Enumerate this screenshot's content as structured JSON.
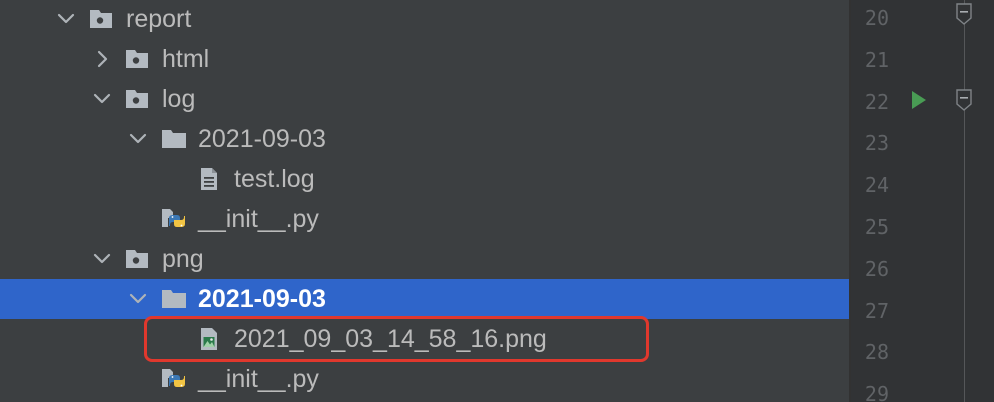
{
  "tree": {
    "rows": [
      {
        "label": "report",
        "icon": "package-folder-icon",
        "chevron": "expanded",
        "selected": false
      },
      {
        "label": "html",
        "icon": "package-folder-icon",
        "chevron": "collapsed",
        "selected": false
      },
      {
        "label": "log",
        "icon": "package-folder-icon",
        "chevron": "expanded",
        "selected": false
      },
      {
        "label": "2021-09-03",
        "icon": "folder-icon",
        "chevron": "expanded",
        "selected": false
      },
      {
        "label": "test.log",
        "icon": "text-file-icon",
        "chevron": "none",
        "selected": false
      },
      {
        "label": "__init__.py",
        "icon": "python-file-icon",
        "chevron": "none",
        "selected": false
      },
      {
        "label": "png",
        "icon": "package-folder-icon",
        "chevron": "expanded",
        "selected": false
      },
      {
        "label": "2021-09-03",
        "icon": "folder-icon",
        "chevron": "expanded",
        "selected": true
      },
      {
        "label": "2021_09_03_14_58_16.png",
        "icon": "image-file-icon",
        "chevron": "none",
        "selected": false
      },
      {
        "label": "__init__.py",
        "icon": "python-file-icon",
        "chevron": "none",
        "selected": false
      }
    ]
  },
  "gutter": {
    "line_numbers": [
      "20",
      "21",
      "22",
      "23",
      "24",
      "25",
      "26",
      "27",
      "28",
      "29"
    ],
    "run_icon": "run-icon"
  },
  "colors": {
    "panel_background": "#3c3f41",
    "gutter_background": "#313335",
    "selection": "#2f65ca",
    "highlight_border": "#e0382d",
    "run_green": "#499c54",
    "text": "#bbbbbb",
    "line_number": "#606366"
  }
}
